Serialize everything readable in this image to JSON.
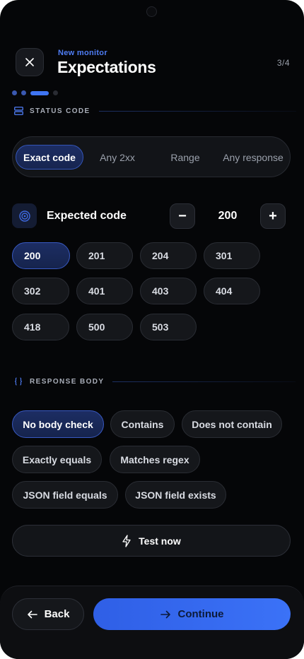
{
  "header": {
    "subtitle": "New monitor",
    "title": "Expectations",
    "step": "3/4",
    "close_icon": "close-icon"
  },
  "status_section": {
    "label": "STATUS CODE",
    "icon": "server-icon",
    "modes": [
      "Exact code",
      "Any 2xx",
      "Range",
      "Any response"
    ],
    "selected_mode": "Exact code"
  },
  "expected_code": {
    "label": "Expected code",
    "icon": "target-icon",
    "value": "200",
    "decrement": "−",
    "increment": "+"
  },
  "code_chips": [
    "200",
    "201",
    "204",
    "301",
    "302",
    "401",
    "403",
    "404",
    "418",
    "500",
    "503"
  ],
  "selected_code": "200",
  "body_section": {
    "label": "RESPONSE BODY",
    "icon": "braces-icon",
    "options": [
      "No body check",
      "Contains",
      "Does not contain",
      "Exactly equals",
      "Matches regex",
      "JSON field equals",
      "JSON field exists"
    ],
    "selected": "No body check"
  },
  "test_button": {
    "label": "Test now",
    "icon": "lightning-icon"
  },
  "footer": {
    "back_label": "Back",
    "continue_label": "Continue"
  },
  "colors": {
    "background": "#050608",
    "accent": "#3f75f3",
    "selected_fill": "#1c2d63"
  }
}
